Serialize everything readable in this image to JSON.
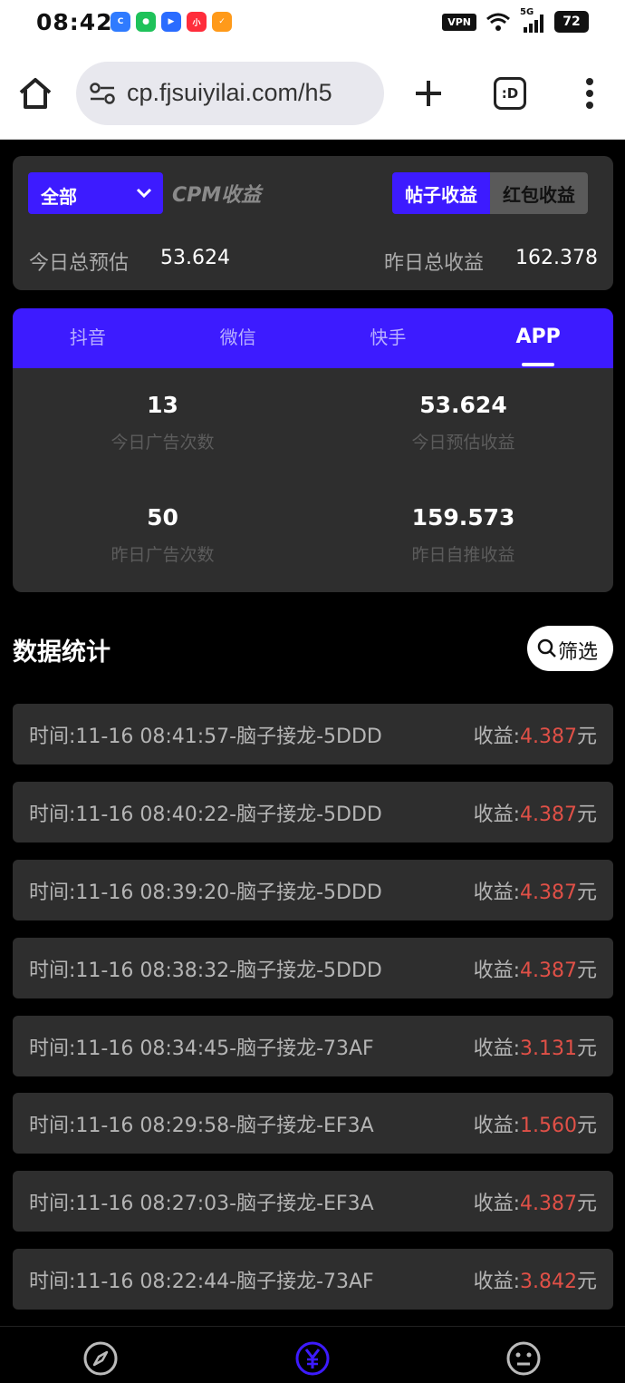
{
  "status_bar": {
    "time": "08:42",
    "app_icons": [
      "baidu-app-icon",
      "wechat-app-icon",
      "bluebird-app-icon",
      "xiaohongshu-app-icon",
      "taobao-app-icon"
    ],
    "vpn": "VPN",
    "signal": "5G",
    "battery": "72"
  },
  "browser": {
    "url": "cp.fjsuiyilai.com/h5",
    "tabs_label": ":D"
  },
  "summary": {
    "selector_label": "全部",
    "cpm_label": "CPM收益",
    "segments": [
      {
        "label": "帖子收益",
        "active": true
      },
      {
        "label": "红包收益",
        "active": false
      }
    ],
    "today_label": "今日总预估",
    "today_value": "53.624",
    "yesterday_label": "昨日总收益",
    "yesterday_value": "162.378"
  },
  "platform": {
    "tabs": [
      {
        "label": "抖音",
        "active": false
      },
      {
        "label": "微信",
        "active": false
      },
      {
        "label": "快手",
        "active": false
      },
      {
        "label": "APP",
        "active": true
      }
    ],
    "stats": [
      {
        "value": "13",
        "label": "今日广告次数"
      },
      {
        "value": "53.624",
        "label": "今日预估收益"
      },
      {
        "value": "50",
        "label": "昨日广告次数"
      },
      {
        "value": "159.573",
        "label": "昨日自推收益"
      }
    ]
  },
  "data_section": {
    "title": "数据统计",
    "filter_label": "筛选",
    "income_prefix": "收益:",
    "currency": "元",
    "records": [
      {
        "desc": "时间:11-16 08:41:57-脑子接龙-5DDD",
        "amount": "4.387"
      },
      {
        "desc": "时间:11-16 08:40:22-脑子接龙-5DDD",
        "amount": "4.387"
      },
      {
        "desc": "时间:11-16 08:39:20-脑子接龙-5DDD",
        "amount": "4.387"
      },
      {
        "desc": "时间:11-16 08:38:32-脑子接龙-5DDD",
        "amount": "4.387"
      },
      {
        "desc": "时间:11-16 08:34:45-脑子接龙-73AF",
        "amount": "3.131"
      },
      {
        "desc": "时间:11-16 08:29:58-脑子接龙-EF3A",
        "amount": "1.560"
      },
      {
        "desc": "时间:11-16 08:27:03-脑子接龙-EF3A",
        "amount": "4.387"
      },
      {
        "desc": "时间:11-16 08:22:44-脑子接龙-73AF",
        "amount": "3.842"
      }
    ]
  },
  "bottom_nav": {
    "items": [
      {
        "icon": "compass-icon",
        "active": false
      },
      {
        "icon": "yen-icon",
        "active": true
      },
      {
        "icon": "smiley-icon",
        "active": false
      }
    ]
  },
  "colors": {
    "accent": "#3d1bff",
    "card_bg": "#2e2e2e",
    "amount_red": "#e05047",
    "muted_label": "#5c5c5c"
  }
}
